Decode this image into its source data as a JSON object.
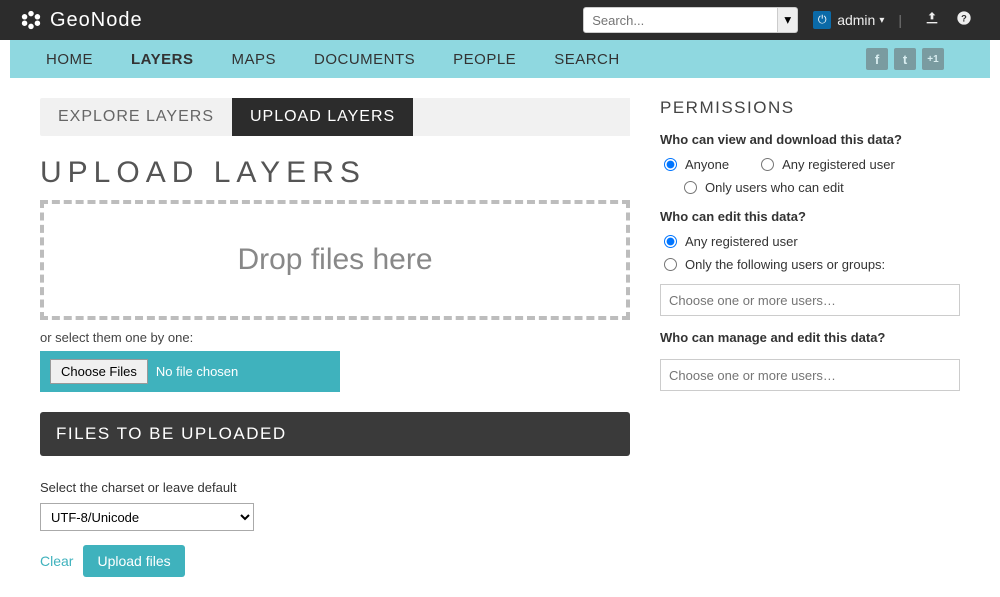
{
  "brand": "GeoNode",
  "search": {
    "placeholder": "Search..."
  },
  "user": {
    "name": "admin"
  },
  "nav": {
    "items": [
      "HOME",
      "LAYERS",
      "MAPS",
      "DOCUMENTS",
      "PEOPLE",
      "SEARCH"
    ],
    "active_index": 1
  },
  "subtabs": {
    "explore": "EXPLORE LAYERS",
    "upload": "UPLOAD LAYERS"
  },
  "page_title": "UPLOAD LAYERS",
  "dropzone": "Drop files here",
  "or_text": "or select them one by one:",
  "choose_files": "Choose Files",
  "no_file": "No file chosen",
  "files_header": "FILES TO BE UPLOADED",
  "charset_label": "Select the charset or leave default",
  "charset_value": "UTF-8/Unicode",
  "clear": "Clear",
  "upload_btn": "Upload files",
  "permissions": {
    "title": "PERMISSIONS",
    "view_q": "Who can view and download this data?",
    "view_opts": [
      "Anyone",
      "Any registered user",
      "Only users who can edit"
    ],
    "edit_q": "Who can edit this data?",
    "edit_opts": [
      "Any registered user",
      "Only the following users or groups:"
    ],
    "users_placeholder": "Choose one or more users…",
    "manage_q": "Who can manage and edit this data?"
  }
}
